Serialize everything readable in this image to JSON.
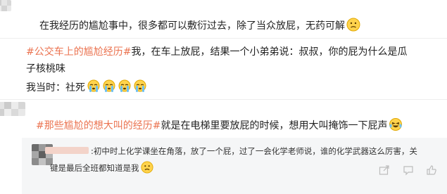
{
  "comments": [
    {
      "text": "在我经历的尴尬事中，很多都可以敷衍过去，除了当众放屁，无药可解",
      "emoji": "sad-face-emoji"
    },
    {
      "tag": "#公交车上的尴尬经历#",
      "line1_rest": "我，在车上放屁，结果一个小弟弟说：叔叔，你的屁为什么是瓜",
      "line2": "子核桃味",
      "line3": "我当时：社死",
      "emojis": [
        "cry-emoji",
        "cry-emoji",
        "cry-emoji",
        "cry-emoji"
      ]
    },
    {
      "tag": "#那些尴尬的想大叫的经历#",
      "rest": "就是在电梯里要放屁的时候，想用大叫掩饰一下屁声",
      "emoji": "laugh-cry-emoji",
      "reply": {
        "line1": ":初中时上化学课坐在角落，放了一个屁，过了一会化学老师说，谁的化学武器这么厉害，关",
        "line2": "键是最后全班都知道是我",
        "emoji": "sad-face-emoji"
      }
    }
  ],
  "colors": {
    "tag": "#eb7350",
    "reply_bg": "#f5f6f7",
    "icon": "#bcbcbc"
  },
  "actions": [
    "share-icon",
    "comment-icon",
    "like-icon"
  ]
}
